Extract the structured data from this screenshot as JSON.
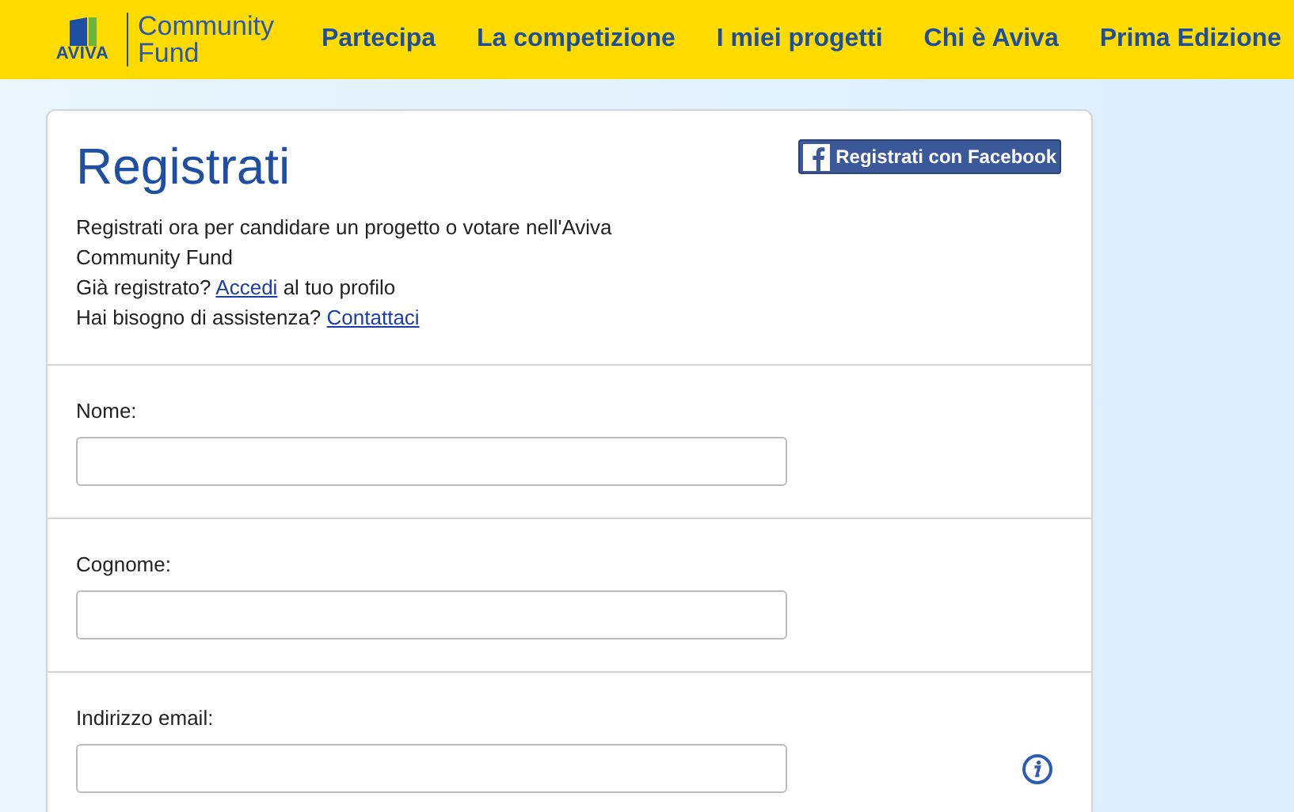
{
  "logo": {
    "brand": "AVIVA",
    "name_line1": "Community",
    "name_line2": "Fund"
  },
  "nav": [
    {
      "label": "Partecipa"
    },
    {
      "label": "La competizione"
    },
    {
      "label": "I miei progetti"
    },
    {
      "label": "Chi è Aviva"
    },
    {
      "label": "Prima Edizione"
    }
  ],
  "form": {
    "title": "Registrati",
    "facebook_button": "Registrati con Facebook",
    "intro": "Registrati ora per candidare un progetto o votare nell'Aviva Community Fund",
    "lines": [
      {
        "before": "Già registrato?",
        "link": "Accedi",
        "after": "al tuo profilo"
      },
      {
        "before": "Hai bisogno di assistenza?",
        "link": "Contattaci"
      }
    ],
    "fields": [
      {
        "label": "Nome:",
        "info": false
      },
      {
        "label": "Cognome:",
        "info": false
      },
      {
        "label": "Indirizzo email:",
        "info": true
      }
    ]
  }
}
